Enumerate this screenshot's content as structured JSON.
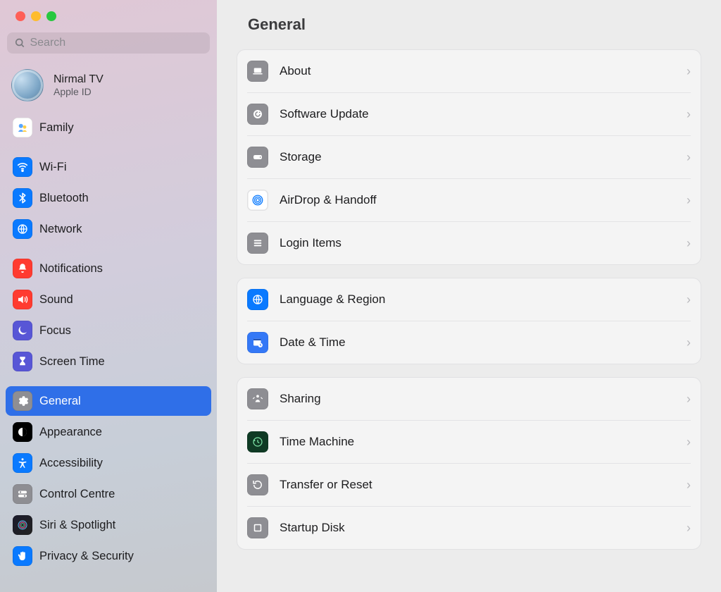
{
  "search": {
    "placeholder": "Search"
  },
  "account": {
    "name": "Nirmal TV",
    "sub": "Apple ID"
  },
  "sidebar": {
    "family": "Family",
    "groups": [
      {
        "items": [
          {
            "id": "wifi",
            "label": "Wi-Fi",
            "color": "#0a7aff"
          },
          {
            "id": "bluetooth",
            "label": "Bluetooth",
            "color": "#0a7aff"
          },
          {
            "id": "network",
            "label": "Network",
            "color": "#0a7aff"
          }
        ]
      },
      {
        "items": [
          {
            "id": "notifications",
            "label": "Notifications",
            "color": "#ff3b30"
          },
          {
            "id": "sound",
            "label": "Sound",
            "color": "#ff3b30"
          },
          {
            "id": "focus",
            "label": "Focus",
            "color": "#5856d6"
          },
          {
            "id": "screentime",
            "label": "Screen Time",
            "color": "#5856d6"
          }
        ]
      },
      {
        "items": [
          {
            "id": "general",
            "label": "General",
            "color": "#8e8e93",
            "selected": true
          },
          {
            "id": "appearance",
            "label": "Appearance",
            "color": "#000000"
          },
          {
            "id": "accessibility",
            "label": "Accessibility",
            "color": "#0a7aff"
          },
          {
            "id": "controlcentre",
            "label": "Control Centre",
            "color": "#8e8e93"
          },
          {
            "id": "siri",
            "label": "Siri & Spotlight",
            "color": "#222"
          },
          {
            "id": "privacy",
            "label": "Privacy & Security",
            "color": "#0a7aff"
          }
        ]
      }
    ]
  },
  "main": {
    "title": "General",
    "groups": [
      {
        "items": [
          {
            "id": "about",
            "label": "About",
            "bg": "#8e8e93"
          },
          {
            "id": "softwareupdate",
            "label": "Software Update",
            "bg": "#8e8e93"
          },
          {
            "id": "storage",
            "label": "Storage",
            "bg": "#8e8e93"
          },
          {
            "id": "airdrop",
            "label": "AirDrop & Handoff",
            "bg": "#ffffff"
          },
          {
            "id": "loginitems",
            "label": "Login Items",
            "bg": "#8e8e93"
          }
        ]
      },
      {
        "items": [
          {
            "id": "language",
            "label": "Language & Region",
            "bg": "#0a7aff"
          },
          {
            "id": "datetime",
            "label": "Date & Time",
            "bg": "#3478f6"
          }
        ]
      },
      {
        "items": [
          {
            "id": "sharing",
            "label": "Sharing",
            "bg": "#8e8e93"
          },
          {
            "id": "timemachine",
            "label": "Time Machine",
            "bg": "#0f2f1a"
          },
          {
            "id": "transfer",
            "label": "Transfer or Reset",
            "bg": "#8e8e93"
          },
          {
            "id": "startupdisk",
            "label": "Startup Disk",
            "bg": "#8e8e93"
          }
        ]
      }
    ]
  }
}
